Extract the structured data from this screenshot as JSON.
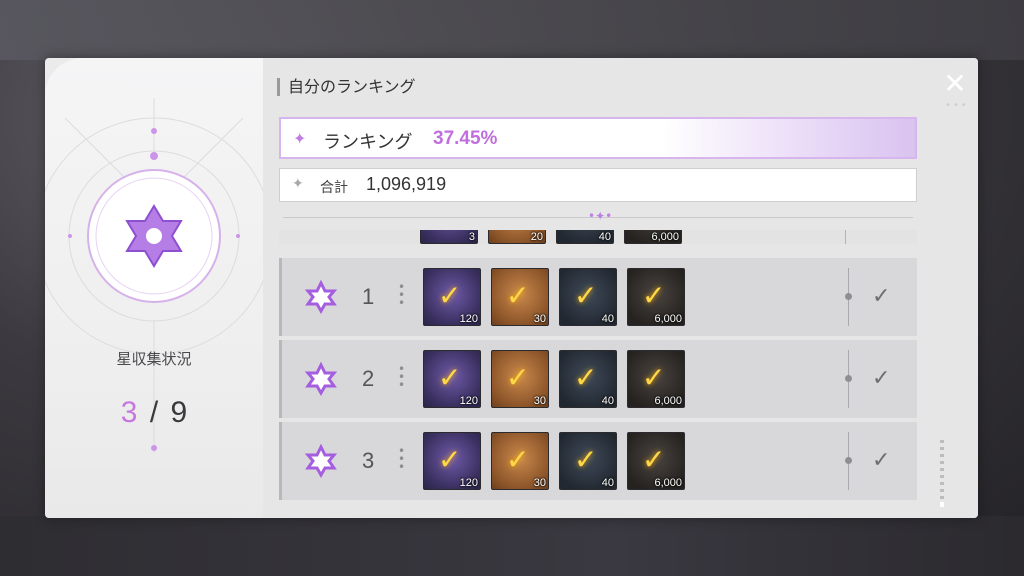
{
  "window": {
    "close_icon": "close-icon"
  },
  "star_collection": {
    "label": "星収集状況",
    "current": "3",
    "separator": "/",
    "total": "9"
  },
  "ranking_panel": {
    "title": "自分のランキング",
    "ranking_label": "ランキング",
    "ranking_value": "37.45%",
    "total_label": "合計",
    "total_value": "1,096,919"
  },
  "partial_row": {
    "items": [
      {
        "quantity": "3",
        "style": "purple"
      },
      {
        "quantity": "20",
        "style": "orange"
      },
      {
        "quantity": "40",
        "style": "dark"
      },
      {
        "quantity": "6,000",
        "style": "gold"
      }
    ]
  },
  "reward_rows": [
    {
      "rank": "1",
      "claimed": true,
      "items": [
        {
          "quantity": "120"
        },
        {
          "quantity": "30"
        },
        {
          "quantity": "40"
        },
        {
          "quantity": "6,000"
        }
      ]
    },
    {
      "rank": "2",
      "claimed": true,
      "items": [
        {
          "quantity": "120"
        },
        {
          "quantity": "30"
        },
        {
          "quantity": "40"
        },
        {
          "quantity": "6,000"
        }
      ]
    },
    {
      "rank": "3",
      "claimed": true,
      "items": [
        {
          "quantity": "120"
        },
        {
          "quantity": "30"
        },
        {
          "quantity": "40"
        },
        {
          "quantity": "6,000"
        }
      ]
    }
  ],
  "colors": {
    "accent": "#c16fde",
    "check": "#ffd84a"
  }
}
